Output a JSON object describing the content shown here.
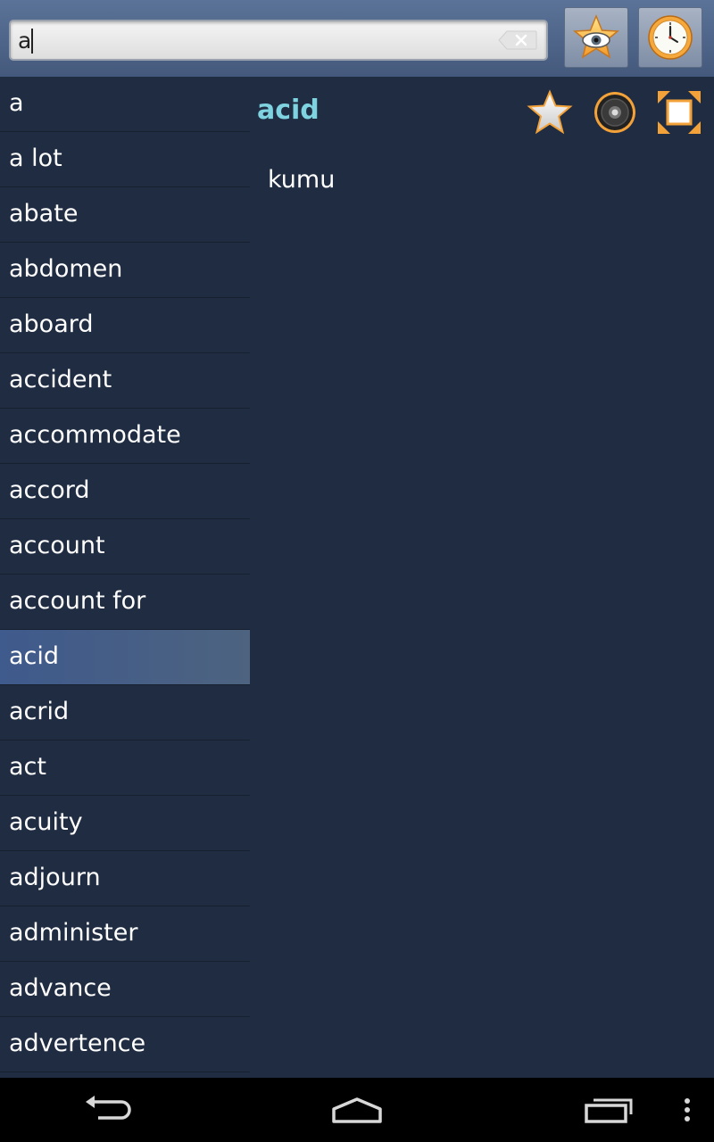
{
  "search": {
    "value": "a",
    "placeholder": ""
  },
  "icons": {
    "clear": "clear-x-icon",
    "favorites": "star-eye-icon",
    "history": "clock-icon",
    "add_favorite": "star-icon",
    "pronounce": "speaker-icon",
    "fullscreen": "expand-icon",
    "back": "back-arrow-icon",
    "home": "home-icon",
    "recents": "recent-apps-icon",
    "menu": "overflow-menu-icon"
  },
  "word_list": {
    "items": [
      {
        "label": "a"
      },
      {
        "label": "a lot"
      },
      {
        "label": "abate"
      },
      {
        "label": "abdomen"
      },
      {
        "label": "aboard"
      },
      {
        "label": "accident"
      },
      {
        "label": "accommodate"
      },
      {
        "label": "accord"
      },
      {
        "label": "account"
      },
      {
        "label": "account for"
      },
      {
        "label": "acid"
      },
      {
        "label": "acrid"
      },
      {
        "label": "act"
      },
      {
        "label": "acuity"
      },
      {
        "label": "adjourn"
      },
      {
        "label": "administer"
      },
      {
        "label": "advance"
      },
      {
        "label": "advertence"
      }
    ],
    "selected_label": "acid"
  },
  "detail": {
    "word": "acid",
    "translation": "kumu"
  },
  "colors": {
    "background": "#1f2c42",
    "accent_word": "#7fd3e0",
    "selected_row": "#3f5a8c",
    "icon_orange": "#f3a23a"
  }
}
